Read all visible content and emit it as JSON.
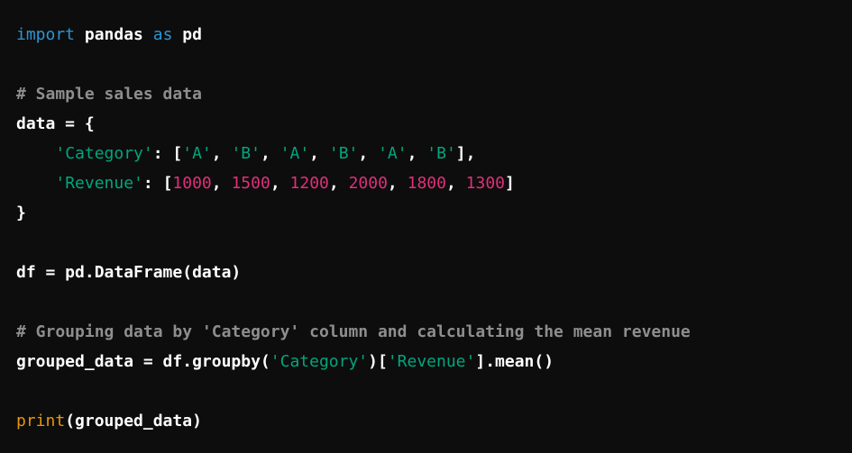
{
  "code": {
    "language": "python",
    "colors": {
      "background": "#0d0d0d",
      "keyword": "#2e95d3",
      "comment": "#8e8e8e",
      "string": "#00a67d",
      "number": "#df3079",
      "builtin": "#e9950c",
      "text": "#ffffff"
    },
    "lines": [
      {
        "t1": "import",
        "t2": " pandas ",
        "t3": "as",
        "t4": " pd"
      },
      {},
      {
        "comment": "# Sample sales data"
      },
      {
        "text": "data = {"
      },
      {
        "indent": "    ",
        "key": "'Category'",
        "sep": ": [",
        "v1": "'A'",
        "v2": "'B'",
        "v3": "'A'",
        "v4": "'B'",
        "v5": "'A'",
        "v6": "'B'",
        "comma": ", ",
        "end": "],"
      },
      {
        "indent": "    ",
        "key": "'Revenue'",
        "sep": ": [",
        "v1": "1000",
        "v2": "1500",
        "v3": "1200",
        "v4": "2000",
        "v5": "1800",
        "v6": "1300",
        "comma": ", ",
        "end": "]"
      },
      {
        "text": "}"
      },
      {},
      {
        "text": "df = pd.DataFrame(data)"
      },
      {},
      {
        "comment": "# Grouping data by 'Category' column and calculating the mean revenue"
      },
      {
        "p1": "grouped_data = df.groupby(",
        "s1": "'Category'",
        "p2": ")[",
        "s2": "'Revenue'",
        "p3": "].mean()"
      },
      {},
      {
        "fn": "print",
        "rest": "(grouped_data)"
      }
    ]
  }
}
